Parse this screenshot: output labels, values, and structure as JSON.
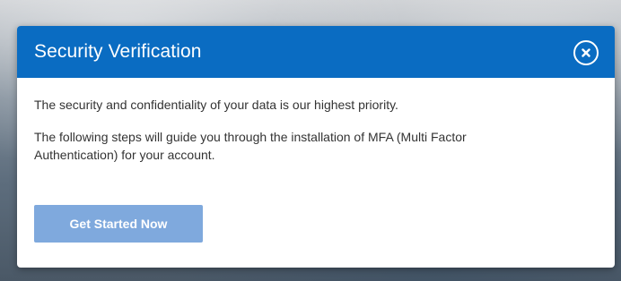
{
  "dialog": {
    "title": "Security Verification",
    "close_icon": "close-icon",
    "paragraph_1": "The security and confidentiality of your data is our highest priority.",
    "paragraph_2": "The following steps will guide you through the installation of MFA (Multi Factor Authentication) for your account.",
    "cta_label": "Get Started Now"
  },
  "colors": {
    "header_bg": "#0a6cc2",
    "header_text": "#ffffff",
    "body_text": "#333333",
    "cta_bg": "#7fa9dd",
    "cta_text": "#ffffff"
  }
}
